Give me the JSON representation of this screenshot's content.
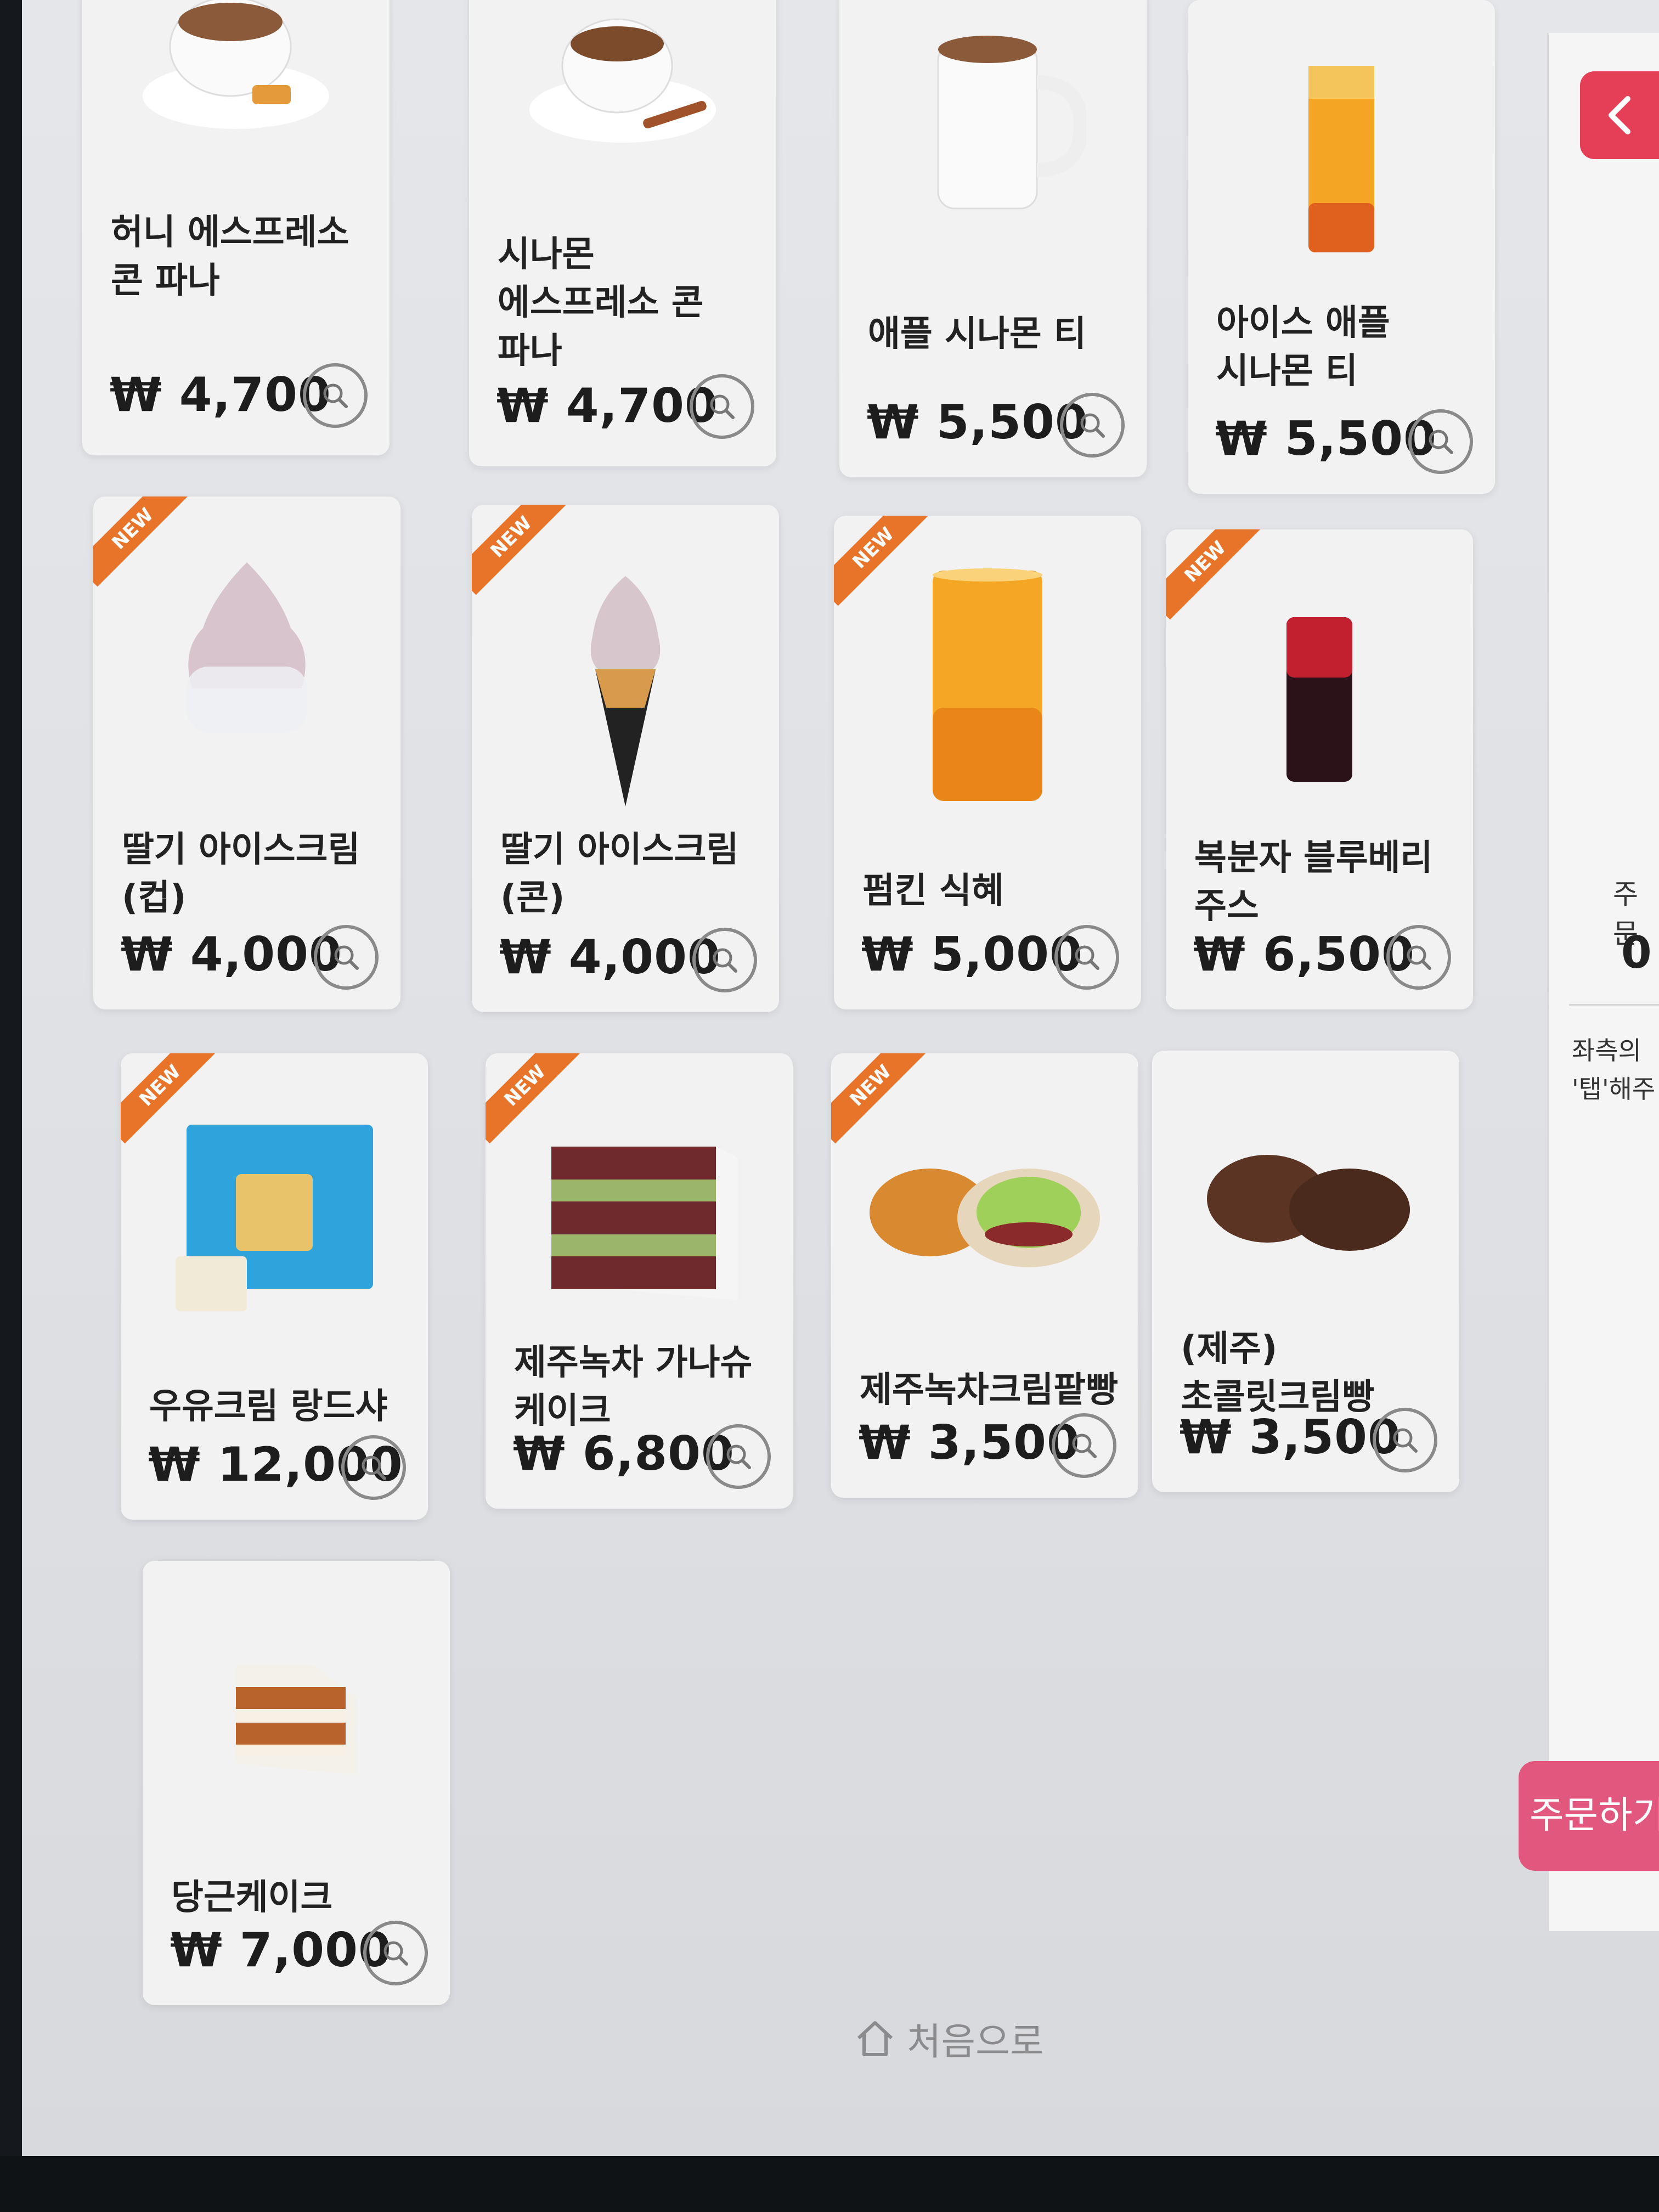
{
  "menu": {
    "items": [
      {
        "name": "허니 에스프레소 콘 파나",
        "price": "₩ 4,700",
        "is_new": false,
        "icon": "coffee-cup-icon"
      },
      {
        "name": "시나몬 에스프레소 콘 파나",
        "price": "₩ 4,700",
        "is_new": false,
        "icon": "coffee-cup-icon"
      },
      {
        "name": "애플 시나몬 티",
        "price": "₩ 5,500",
        "is_new": false,
        "icon": "mug-icon"
      },
      {
        "name": "아이스 애플 시나몬 티",
        "price": "₩ 5,500",
        "is_new": false,
        "icon": "iced-drink-icon"
      },
      {
        "name": "딸기 아이스크림 (컵)",
        "price": "₩ 4,000",
        "is_new": true,
        "icon": "ice-cream-cup-icon"
      },
      {
        "name": "딸기 아이스크림 (콘)",
        "price": "₩ 4,000",
        "is_new": true,
        "icon": "ice-cream-cone-icon"
      },
      {
        "name": "펌킨 식혜",
        "price": "₩ 5,000",
        "is_new": true,
        "icon": "tall-glass-icon"
      },
      {
        "name": "복분자 블루베리 주스",
        "price": "₩ 6,500",
        "is_new": true,
        "icon": "juice-glass-icon"
      },
      {
        "name": "우유크림 랑드샤",
        "price": "₩ 12,000",
        "is_new": true,
        "icon": "cookie-box-icon"
      },
      {
        "name": "제주녹차 가나슈 케이크",
        "price": "₩ 6,800",
        "is_new": true,
        "icon": "layer-cake-icon"
      },
      {
        "name": "제주녹차크림팥빵",
        "price": "₩ 3,500",
        "is_new": true,
        "icon": "bread-icon"
      },
      {
        "name": "(제주) 초콜릿크림빵",
        "price": "₩ 3,500",
        "is_new": false,
        "icon": "chocolate-bread-icon"
      },
      {
        "name": "당근케이크",
        "price": "₩ 7,000",
        "is_new": false,
        "icon": "carrot-cake-icon"
      }
    ],
    "new_badge_label": "NEW"
  },
  "side_panel": {
    "order_label": "주문",
    "order_count": "0",
    "hint_line1": "좌측의",
    "hint_line2": "'탭'해주",
    "order_button_label": "주문하기"
  },
  "footer": {
    "home_label": "처음으로"
  },
  "colors": {
    "accent_red": "#e53e57",
    "new_orange": "#e8742a",
    "order_pink": "#e2577d"
  }
}
